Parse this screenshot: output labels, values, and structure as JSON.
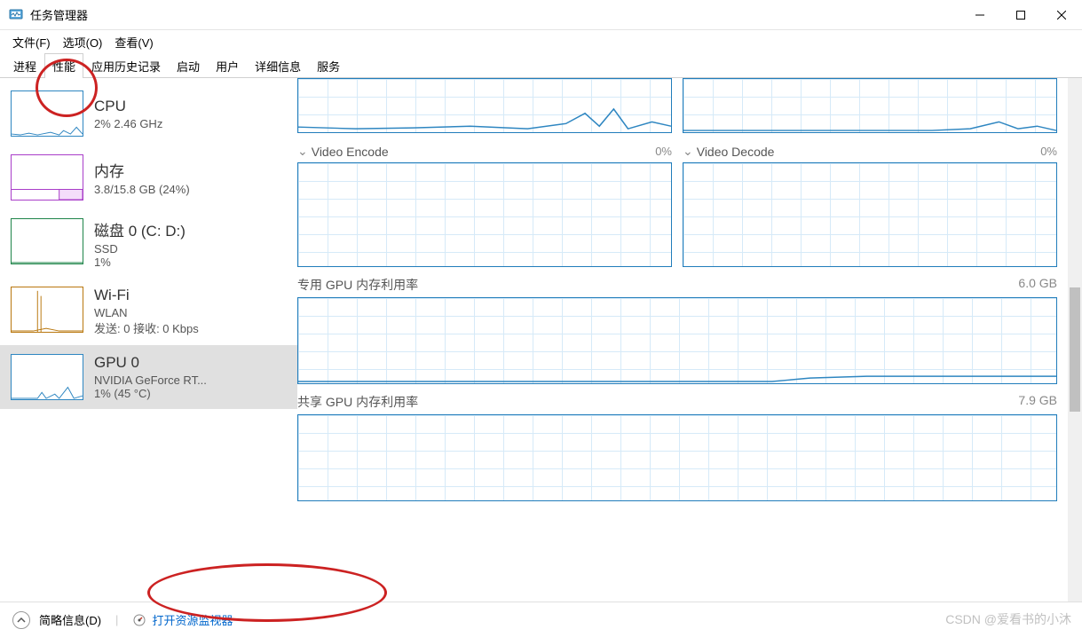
{
  "window": {
    "title": "任务管理器"
  },
  "menu": {
    "file": "文件(F)",
    "options": "选项(O)",
    "view": "查看(V)"
  },
  "tabs": {
    "processes": "进程",
    "performance": "性能",
    "app_history": "应用历史记录",
    "startup": "启动",
    "users": "用户",
    "details": "详细信息",
    "services": "服务"
  },
  "sidebar": {
    "cpu": {
      "title": "CPU",
      "sub": "2%  2.46 GHz",
      "color": "#2e86c1"
    },
    "memory": {
      "title": "内存",
      "sub": "3.8/15.8 GB (24%)",
      "color": "#a93ec9"
    },
    "disk": {
      "title": "磁盘 0 (C: D:)",
      "sub": "SSD",
      "sub2": "1%",
      "color": "#1e8449"
    },
    "wifi": {
      "title": "Wi-Fi",
      "sub": "WLAN",
      "sub2": "发送: 0  接收: 0 Kbps",
      "color": "#b9770e"
    },
    "gpu": {
      "title": "GPU 0",
      "sub": "NVIDIA GeForce RT...",
      "sub2": "1%  (45 °C)",
      "color": "#2e86c1"
    }
  },
  "detail": {
    "video_encode": {
      "label": "Video Encode",
      "value": "0%"
    },
    "video_decode": {
      "label": "Video Decode",
      "value": "0%"
    },
    "dedicated_mem": {
      "label": "专用 GPU 内存利用率",
      "value": "6.0 GB"
    },
    "shared_mem": {
      "label": "共享 GPU 内存利用率",
      "value": "7.9 GB"
    }
  },
  "footer": {
    "brief": "简略信息(D)",
    "resource_monitor": "打开资源监视器"
  },
  "watermark": "CSDN @爱看书的小沐"
}
